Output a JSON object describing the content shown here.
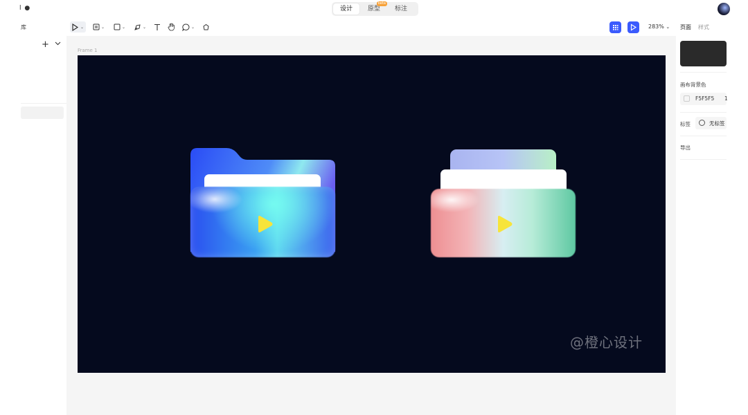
{
  "topbar": {
    "left_text": "l ●",
    "modes": [
      {
        "label": "设计",
        "active": true
      },
      {
        "label": "原型",
        "badge": "beta"
      },
      {
        "label": "标注"
      }
    ]
  },
  "left_panel": {
    "library_label": "库"
  },
  "toolbar": {
    "zoom": "283%"
  },
  "canvas": {
    "frame_label": "Frame 1",
    "watermark": "@橙心设计",
    "background": "#050a1e"
  },
  "right_panel": {
    "tabs": [
      "页面",
      "样式"
    ],
    "canvas_bg_label": "画布背景色",
    "canvas_bg_hex": "F5F5F5",
    "canvas_bg_opacity": "1",
    "tag_label": "标签",
    "tag_value": "无标签",
    "export_label": "导出"
  },
  "colors": {
    "accent": "#3b5bfd",
    "canvas_area": "#f5f5f5"
  }
}
